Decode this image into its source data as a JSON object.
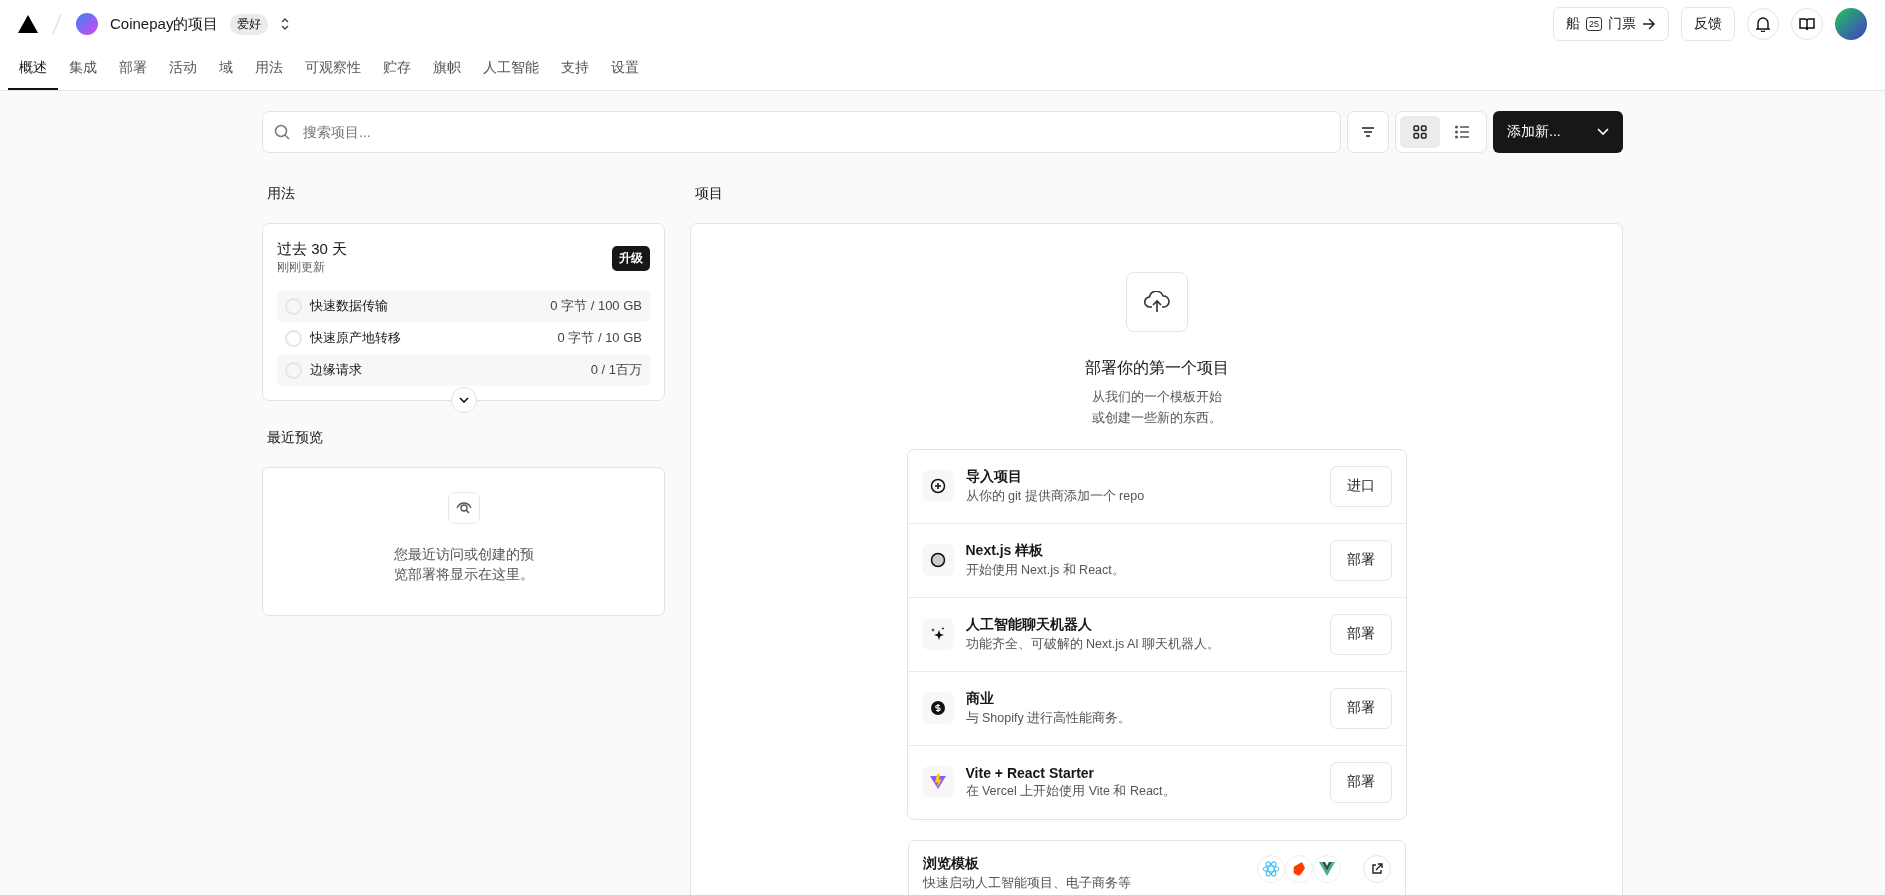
{
  "header": {
    "project": "Coinepay的项目",
    "plan_badge": "爱好",
    "ship_button": {
      "before": "船",
      "badge": "25",
      "after": "门票"
    },
    "feedback_button": "反馈"
  },
  "tabs": [
    {
      "label": "概述",
      "selected": true
    },
    {
      "label": "集成",
      "selected": false
    },
    {
      "label": "部署",
      "selected": false
    },
    {
      "label": "活动",
      "selected": false
    },
    {
      "label": "域",
      "selected": false
    },
    {
      "label": "用法",
      "selected": false
    },
    {
      "label": "可观察性",
      "selected": false
    },
    {
      "label": "贮存",
      "selected": false
    },
    {
      "label": "旗帜",
      "selected": false
    },
    {
      "label": "人工智能",
      "selected": false
    },
    {
      "label": "支持",
      "selected": false
    },
    {
      "label": "设置",
      "selected": false
    }
  ],
  "toolbar": {
    "search": {
      "placeholder": "搜索项目..."
    },
    "views": [
      {
        "kind": "grid",
        "selected": true
      },
      {
        "kind": "list",
        "selected": false
      }
    ],
    "add_button": "添加新..."
  },
  "usage": {
    "heading": "用法",
    "period": "过去 30 天",
    "updated": "刚刚更新",
    "upgrade_button": "升级",
    "rows": [
      {
        "name": "快速数据传输",
        "value": "0 字节 / 100 GB"
      },
      {
        "name": "快速原产地转移",
        "value": "0 字节 / 10 GB"
      },
      {
        "name": "边缘请求",
        "value": "0 / 1百万"
      }
    ]
  },
  "recent_previews": {
    "heading": "最近预览",
    "empty_text": "您最近访问或创建的预览部署将显示在这里。"
  },
  "projects": {
    "heading": "项目",
    "empty_title": "部署你的第一个项目",
    "empty_lines": [
      "从我们的一个模板开始",
      "或创建一些新的东西。"
    ],
    "templates": [
      {
        "kind": "import",
        "title": "导入项目",
        "description": "从你的 git 提供商添加一个 repo",
        "button": "进口"
      },
      {
        "kind": "nextjs",
        "title": "Next.js 样板",
        "description": "开始使用 Next.js 和 React。",
        "button": "部署"
      },
      {
        "kind": "ai",
        "title": "人工智能聊天机器人",
        "description": "功能齐全、可破解的 Next.js AI 聊天机器人。",
        "button": "部署"
      },
      {
        "kind": "commerce",
        "title": "商业",
        "description": "与 Shopify 进行高性能商务。",
        "button": "部署"
      },
      {
        "kind": "vite",
        "title": "Vite + React Starter",
        "description": "在 Vercel 上开始使用 Vite 和 React。",
        "button": "部署"
      }
    ],
    "browse": {
      "title": "浏览模板",
      "description": "快速启动人工智能项目、电子商务等"
    }
  }
}
